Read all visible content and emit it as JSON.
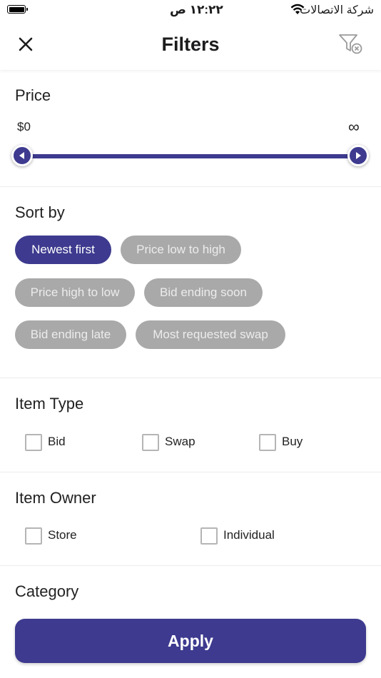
{
  "status_bar": {
    "time": "١٢:٢٢ ص",
    "carrier": "شركة الاتصالات"
  },
  "header": {
    "title": "Filters",
    "close_icon": "close-icon",
    "clear_icon": "filter-clear-icon"
  },
  "price": {
    "title": "Price",
    "min_label": "$0",
    "max_label": "∞",
    "range_min_fraction": 0,
    "range_max_fraction": 1
  },
  "sort": {
    "title": "Sort by",
    "selected": "Newest first",
    "options": [
      "Newest first",
      "Price low to high",
      "Price high to low",
      "Bid ending soon",
      "Bid ending late",
      "Most requested swap"
    ]
  },
  "item_type": {
    "title": "Item Type",
    "options": [
      "Bid",
      "Swap",
      "Buy"
    ]
  },
  "item_owner": {
    "title": "Item Owner",
    "options": [
      "Store",
      "Individual"
    ]
  },
  "category": {
    "title": "Category"
  },
  "apply_label": "Apply",
  "colors": {
    "accent": "#3d3a8f",
    "chip_inactive": "#a9a9a9"
  }
}
